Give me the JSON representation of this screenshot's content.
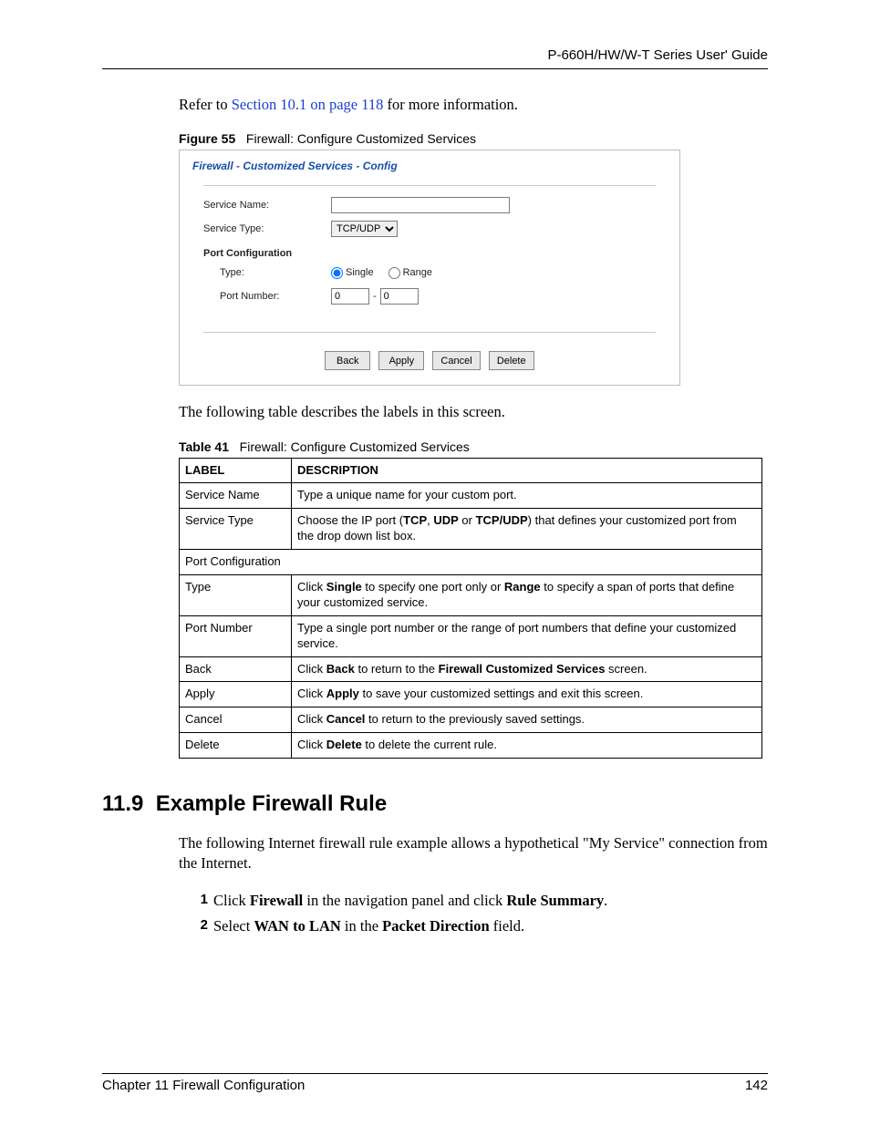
{
  "header": {
    "guide_title": "P-660H/HW/W-T Series User' Guide"
  },
  "para1": {
    "pre": "Refer to ",
    "link": "Section 10.1 on page 118",
    "post": " for more information."
  },
  "figure": {
    "label": "Figure 55",
    "caption": "Firewall: Configure Customized Services"
  },
  "shot": {
    "title": "Firewall - Customized Services - Config",
    "service_name_label": "Service Name:",
    "service_name_value": "",
    "service_type_label": "Service Type:",
    "service_type_value": "TCP/UDP",
    "port_config_heading": "Port Configuration",
    "type_label": "Type:",
    "radio_single": "Single",
    "radio_range": "Range",
    "port_number_label": "Port Number:",
    "port_from": "0",
    "port_sep": "-",
    "port_to": "0",
    "btn_back": "Back",
    "btn_apply": "Apply",
    "btn_cancel": "Cancel",
    "btn_delete": "Delete"
  },
  "para2": "The following table describes the labels in this screen.",
  "table_caption": {
    "label": "Table 41",
    "caption": "Firewall: Configure Customized Services"
  },
  "table": {
    "head_label": "LABEL",
    "head_desc": "DESCRIPTION",
    "rows": [
      {
        "label": "Service Name",
        "desc_html": "Type a unique name for your custom port."
      },
      {
        "label": "Service Type",
        "desc_html": "Choose the IP port (<b>TCP</b>, <b>UDP</b> or <b>TCP/UDP</b>) that defines your customized port from the drop down list box."
      },
      {
        "label": "Port Configuration",
        "span": true
      },
      {
        "label": "Type",
        "desc_html": "Click <b>Single</b> to specify one port only or <b>Range</b> to specify a span of ports that define your customized service."
      },
      {
        "label": "Port Number",
        "desc_html": "Type a single port number or the range of port numbers that define your customized service."
      },
      {
        "label": "Back",
        "desc_html": "Click <b>Back</b> to return to the <b>Firewall Customized Services</b> screen."
      },
      {
        "label": "Apply",
        "desc_html": "Click <b>Apply</b> to save your customized settings and exit this screen."
      },
      {
        "label": "Cancel",
        "desc_html": "Click <b>Cancel</b> to return to the previously saved settings."
      },
      {
        "label": "Delete",
        "desc_html": "Click <b>Delete</b> to delete the current rule."
      }
    ]
  },
  "section": {
    "number": "11.9",
    "title": "Example Firewall Rule",
    "intro": "The following Internet firewall rule example allows a hypothetical \"My Service\" connection from the Internet.",
    "steps": [
      {
        "n": "1",
        "html": "Click <b>Firewall</b> in the navigation panel and click <b>Rule Summary</b>."
      },
      {
        "n": "2",
        "html": "Select <b>WAN to LAN</b> in the <b>Packet Direction</b> field."
      }
    ]
  },
  "footer": {
    "chapter": "Chapter 11 Firewall Configuration",
    "page": "142"
  }
}
